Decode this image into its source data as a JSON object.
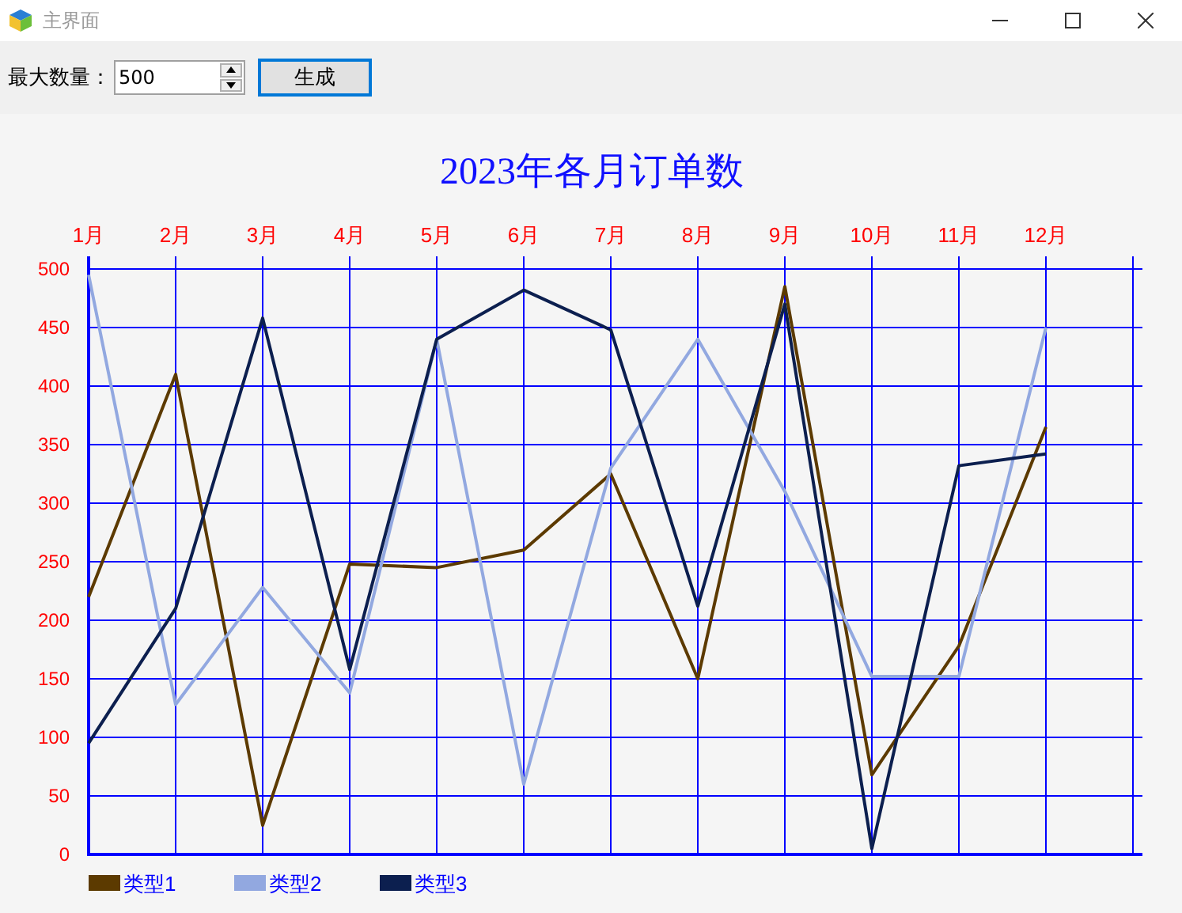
{
  "window": {
    "title": "主界面",
    "active": false
  },
  "toolbar": {
    "label": "最大数量：",
    "spin_value": "500",
    "button": "生成"
  },
  "chart": {
    "chart_data": {
      "type": "line",
      "title": "2023年各月订单数",
      "categories": [
        "1月",
        "2月",
        "3月",
        "4月",
        "5月",
        "6月",
        "7月",
        "8月",
        "9月",
        "10月",
        "11月",
        "12月"
      ],
      "ylim": [
        0,
        500
      ],
      "grid": true,
      "legend": true,
      "yticks": [
        0,
        50,
        100,
        150,
        200,
        250,
        300,
        350,
        400,
        450,
        500
      ],
      "series": [
        {
          "name": "类型1",
          "color": "#5c3a00",
          "values": [
            220,
            410,
            25,
            248,
            245,
            260,
            325,
            150,
            485,
            68,
            178,
            365
          ]
        },
        {
          "name": "类型2",
          "color": "#92a8e0",
          "values": [
            495,
            128,
            228,
            138,
            440,
            60,
            330,
            440,
            310,
            152,
            152,
            450
          ]
        },
        {
          "name": "类型3",
          "color": "#0c1f4f",
          "values": [
            95,
            210,
            458,
            158,
            440,
            482,
            448,
            212,
            470,
            5,
            332,
            342
          ]
        }
      ]
    }
  }
}
